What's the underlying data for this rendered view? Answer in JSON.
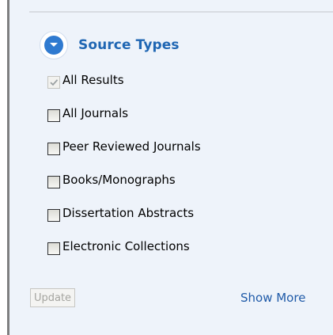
{
  "facet": {
    "title": "Source Types",
    "options": [
      {
        "label": "All Results",
        "checked": true,
        "disabled": true
      },
      {
        "label": "All Journals",
        "checked": false,
        "disabled": false
      },
      {
        "label": "Peer Reviewed Journals",
        "checked": false,
        "disabled": false
      },
      {
        "label": "Books/Monographs",
        "checked": false,
        "disabled": false
      },
      {
        "label": "Dissertation Abstracts",
        "checked": false,
        "disabled": false
      },
      {
        "label": "Electronic Collections",
        "checked": false,
        "disabled": false
      }
    ],
    "update_label": "Update",
    "show_more_label": "Show More"
  },
  "icons": {
    "collapse": "chevron-down-circle-icon",
    "check": "checkmark-icon"
  },
  "colors": {
    "panel_background": "#eef3fa",
    "title": "#1f66b3",
    "link": "#1f5aa8",
    "icon_accent": "#2f7ad0",
    "left_border": "#7e7f80"
  }
}
